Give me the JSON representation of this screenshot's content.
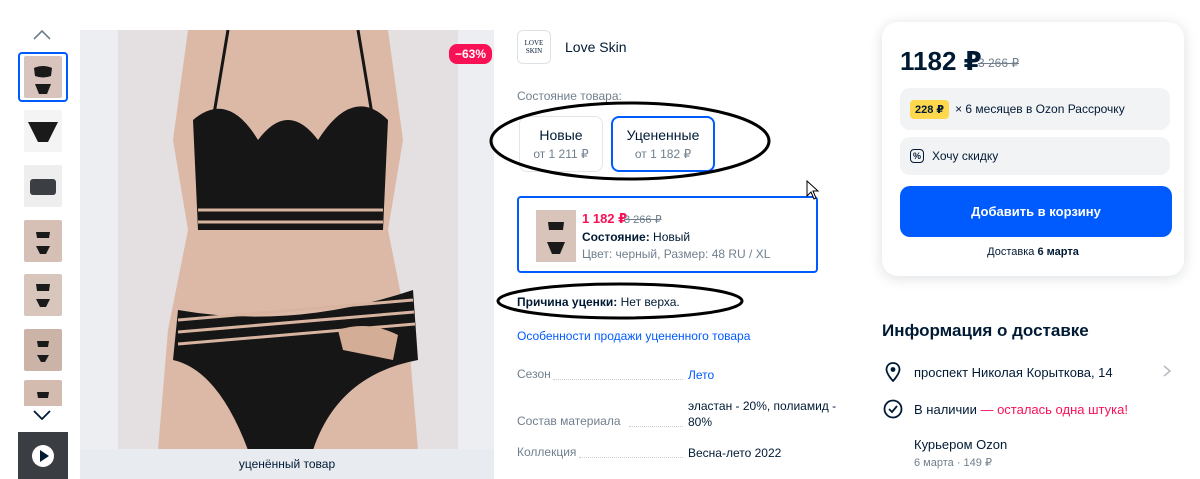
{
  "gallery": {
    "discount_badge": "−63%",
    "caption": "уценённый товар",
    "thumb_count": 9
  },
  "brand": {
    "logo_text_line1": "LOVE",
    "logo_text_line2": "SKIN",
    "name": "Love Skin"
  },
  "condition": {
    "label": "Состояние товара:",
    "options": [
      {
        "title": "Новые",
        "subtitle": "от 1 211 ₽"
      },
      {
        "title": "Уцененные",
        "subtitle": "от 1 182 ₽"
      }
    ]
  },
  "offer": {
    "price": "1 182 ₽",
    "old_price": "3 266 ₽",
    "condition_label": "Состояние:",
    "condition_value": "Новый",
    "attributes": "Цвет: черный, Размер: 48 RU / XL"
  },
  "reason": {
    "label": "Причина уценки:",
    "value": "Нет верха."
  },
  "sale_link": "Особенности продажи уцененного товара",
  "specs": [
    {
      "key": "Сезон",
      "value": "Лето"
    },
    {
      "key": "Состав материала",
      "value": "эластан - 20%, полиамид - 80%"
    },
    {
      "key": "Коллекция",
      "value": "Весна-лето 2022"
    }
  ],
  "buy_box": {
    "price": "1182 ₽",
    "old_price": "3 266 ₽",
    "installment_badge": "228 ₽",
    "installment_text": "× 6 месяцев в Ozon Рассрочку",
    "want_discount": "Хочу скидку",
    "add_to_cart": "Добавить в корзину",
    "delivery_prefix": "Доставка",
    "delivery_date": "6 марта"
  },
  "delivery_info": {
    "title": "Информация о доставке",
    "address": "проспект Николая Корыткова, 14",
    "in_stock": "В наличии",
    "stock_warning": "— осталась одна штука!",
    "courier": "Курьером Ozon",
    "courier_details": "6 марта · 149 ₽"
  },
  "colors": {
    "accent": "#005bff",
    "sale": "#f91155",
    "text": "#001a34",
    "muted": "#707f8d",
    "installment_badge": "#ffd84d"
  }
}
